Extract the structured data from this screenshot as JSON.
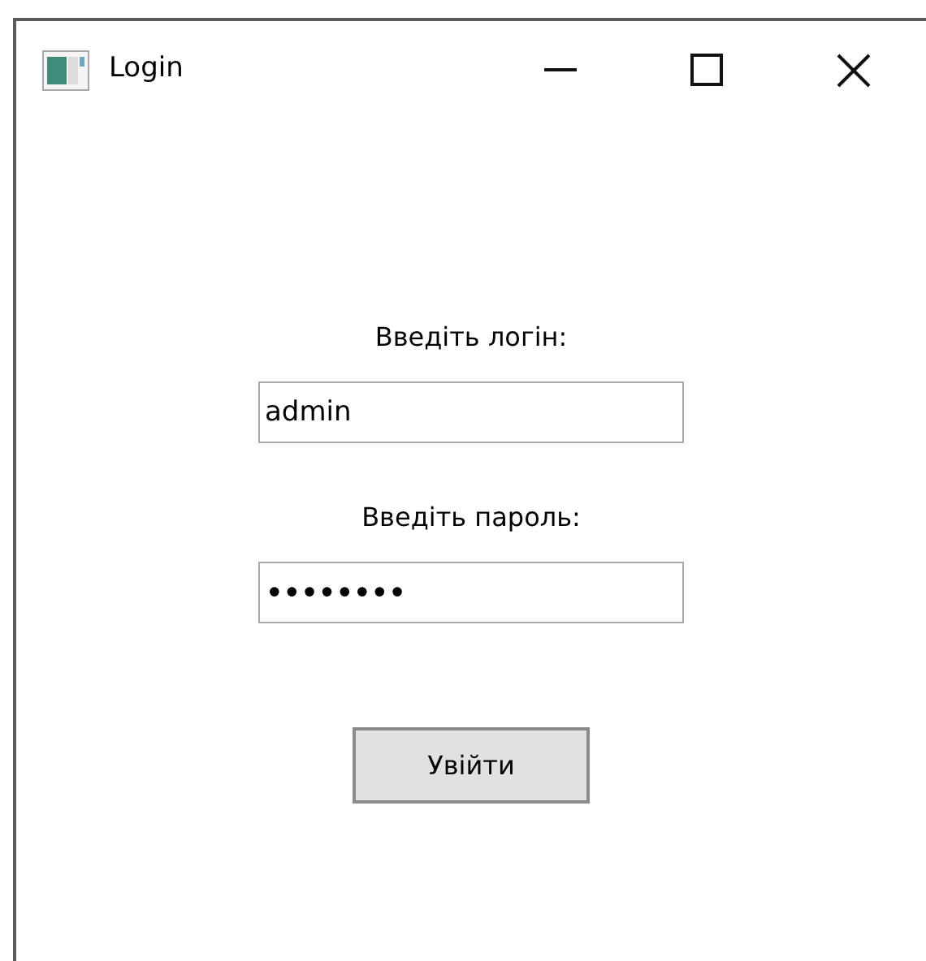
{
  "window": {
    "title": "Login"
  },
  "form": {
    "fields": [
      {
        "kind": "text",
        "label": "Введіть логін:",
        "value": "admin"
      },
      {
        "kind": "password",
        "label": "Введіть пароль:",
        "value": "••••••••"
      }
    ],
    "button": "Увійти"
  }
}
